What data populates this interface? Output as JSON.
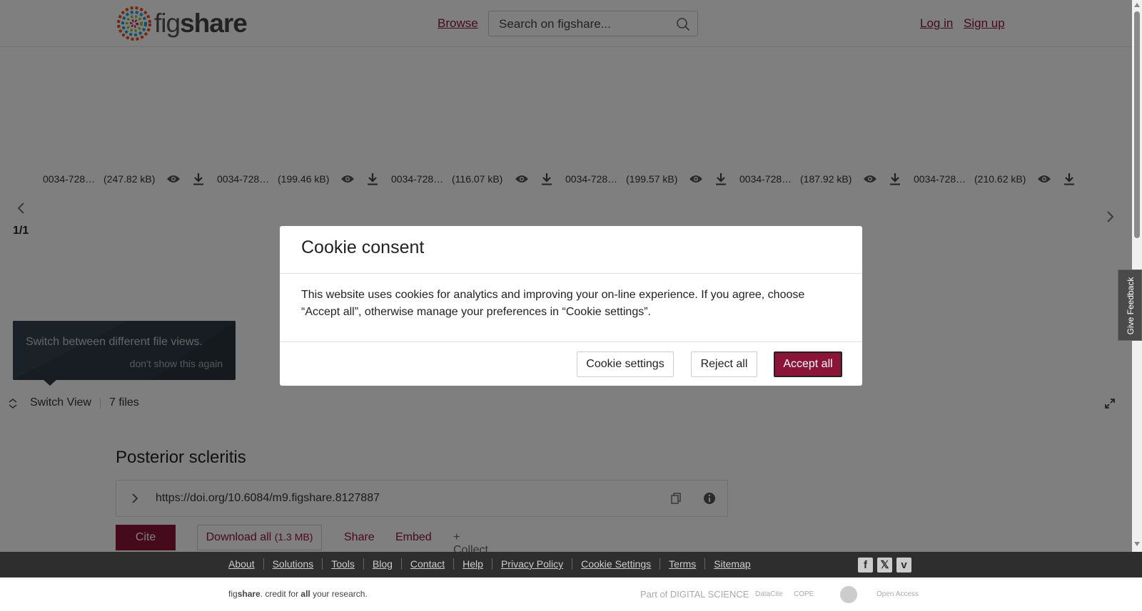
{
  "header": {
    "logo_text_light": "fig",
    "logo_text_bold": "share",
    "browse_label": "Browse",
    "search_placeholder": "Search on figshare...",
    "login_label": "Log in",
    "signup_label": "Sign up"
  },
  "viewer": {
    "files": [
      {
        "name": "0034-728…",
        "size": "(247.82 kB)"
      },
      {
        "name": "0034-728…",
        "size": "(199.46 kB)"
      },
      {
        "name": "0034-728…",
        "size": "(116.07 kB)"
      },
      {
        "name": "0034-728…",
        "size": "(199.57 kB)"
      },
      {
        "name": "0034-728…",
        "size": "(187.92 kB)"
      },
      {
        "name": "0034-728…",
        "size": "(210.62 kB)"
      }
    ],
    "page_indicator": "1/1",
    "tooltip_text": "Switch between different file views.",
    "tooltip_dismiss": "don't show this again",
    "switch_view_label": "Switch View",
    "files_count": "7 files"
  },
  "article": {
    "title": "Posterior scleritis",
    "doi": "https://doi.org/10.6084/m9.figshare.8127887",
    "cite_label": "Cite",
    "download_label": "Download all",
    "download_size": "(1.3 MB)",
    "share_label": "Share",
    "embed_label": "Embed",
    "collect_label": "+ Collect"
  },
  "cookie_modal": {
    "title": "Cookie consent",
    "body": "This website uses cookies for analytics and improving your on-line experience. If you agree, choose “Accept all”, otherwise manage your preferences in “Cookie settings”.",
    "settings_label": "Cookie settings",
    "reject_label": "Reject all",
    "accept_label": "Accept all"
  },
  "feedback_label": "Give Feedback",
  "footer": {
    "links": [
      "About",
      "Solutions",
      "Tools",
      "Blog",
      "Contact",
      "Help",
      "Privacy Policy",
      "Cookie Settings",
      "Terms",
      "Sitemap"
    ],
    "tagline_pre": "fig",
    "tagline_bold": "share",
    "tagline_mid": ". credit for ",
    "tagline_all": "all",
    "tagline_end": " your research.",
    "partners": {
      "digital_science": "Part of DIGITAL SCIENCE",
      "datacite": "DataCite",
      "cope": "COPE",
      "open_access": "Open Access"
    }
  },
  "colors": {
    "brand": "#8b1538",
    "overlay": "rgba(0,0,0,0.5)",
    "footer_bg": "#2e2e2e"
  },
  "icons": [
    "search-icon",
    "eye-icon",
    "download-icon",
    "chevron-left-icon",
    "chevron-right-icon",
    "switch-view-icon",
    "expand-icon",
    "chevron-right-icon",
    "copy-icon",
    "info-icon",
    "facebook-icon",
    "x-icon",
    "vimeo-icon"
  ]
}
